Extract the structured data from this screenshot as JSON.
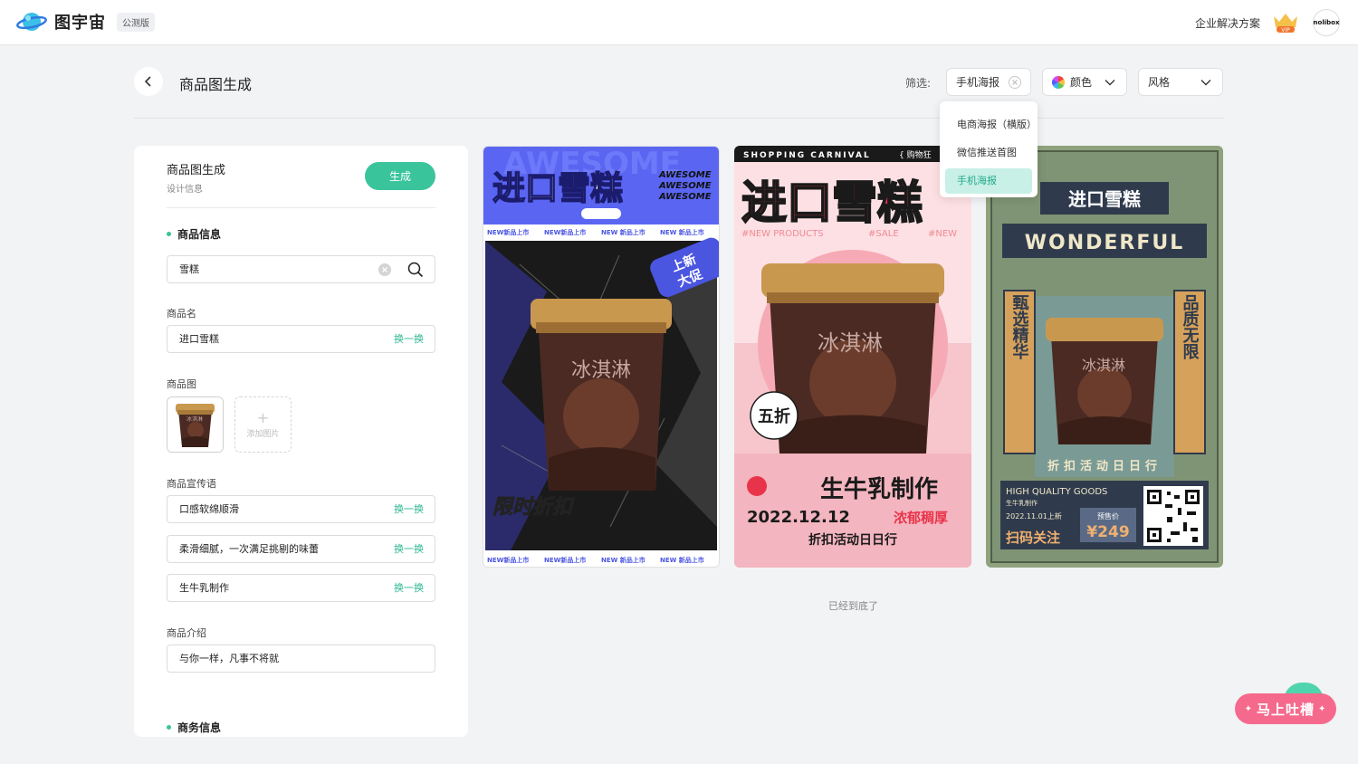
{
  "app": {
    "name": "图宇宙",
    "beta_badge": "公测版",
    "enterprise_link": "企业解决方案",
    "vip_label": "VIP",
    "avatar_text": "nolibox"
  },
  "header": {
    "page_title": "商品图生成",
    "filter_label": "筛选:",
    "filter_selected": "手机海报",
    "color_filter": "颜色",
    "style_filter": "风格"
  },
  "dropdown": {
    "items": [
      "电商海报（横版）",
      "微信推送首图",
      "手机海报"
    ],
    "active_index": 2
  },
  "panel": {
    "title": "商品图生成",
    "subtitle": "设计信息",
    "generate_button": "生成",
    "section_product": "商品信息",
    "search_value": "雪糕",
    "name_label": "商品名",
    "name_value": "进口雪糕",
    "swap_label": "换一换",
    "image_label": "商品图",
    "add_image": "添加图片",
    "slogan_label": "商品宣传语",
    "slogans": [
      "口感软绵顺滑",
      "柔滑细腻，一次满足挑剔的味蕾",
      "生牛乳制作"
    ],
    "intro_label": "商品介绍",
    "intro_value": "与你一样，凡事不将就",
    "section_business": "商务信息"
  },
  "posters": {
    "p1": {
      "title": "进口雪糕",
      "awesome": [
        "AWESOME",
        "AWESOME",
        "AWESOME"
      ],
      "bg_word": "AWESOME",
      "ticker": [
        "NEW新品上市",
        "NEW新品上市",
        "NEW 新品上市",
        "NEW 新品上市"
      ],
      "badge": [
        "上新",
        "大促"
      ],
      "cup_text": "冰淇淋",
      "bottom_title": "限时折扣"
    },
    "p2": {
      "top_banner": "SHOPPING CARNIVAL",
      "top_right": "{ 购物狂",
      "title": "进口雪糕",
      "tags": [
        "#NEW PRODUCTS",
        "#SALE",
        "#NEW"
      ],
      "cup_text": "冰淇淋",
      "badge": "五折",
      "headline": "生牛乳制作",
      "date": "2022.12.12",
      "date_tag": "浓郁稠厚",
      "footer": "折扣活动日日行"
    },
    "p3": {
      "title": "进口雪糕",
      "wonderful": "WONDERFUL",
      "left_vertical": "甄选精华",
      "right_vertical": "品质无限",
      "cup_text": "冰淇淋",
      "footer": "折扣活动日日行",
      "hq": "HIGH QUALITY GOODS",
      "sub": "生牛乳制作",
      "date": "2022.11.01上新",
      "presale": "预售价",
      "price": "¥249",
      "scan": "扫码关注"
    }
  },
  "end_text": "已经到底了",
  "feedback": "马上吐槽",
  "colors": {
    "accent": "#3ac49c",
    "feedback": "#f56a8c"
  }
}
